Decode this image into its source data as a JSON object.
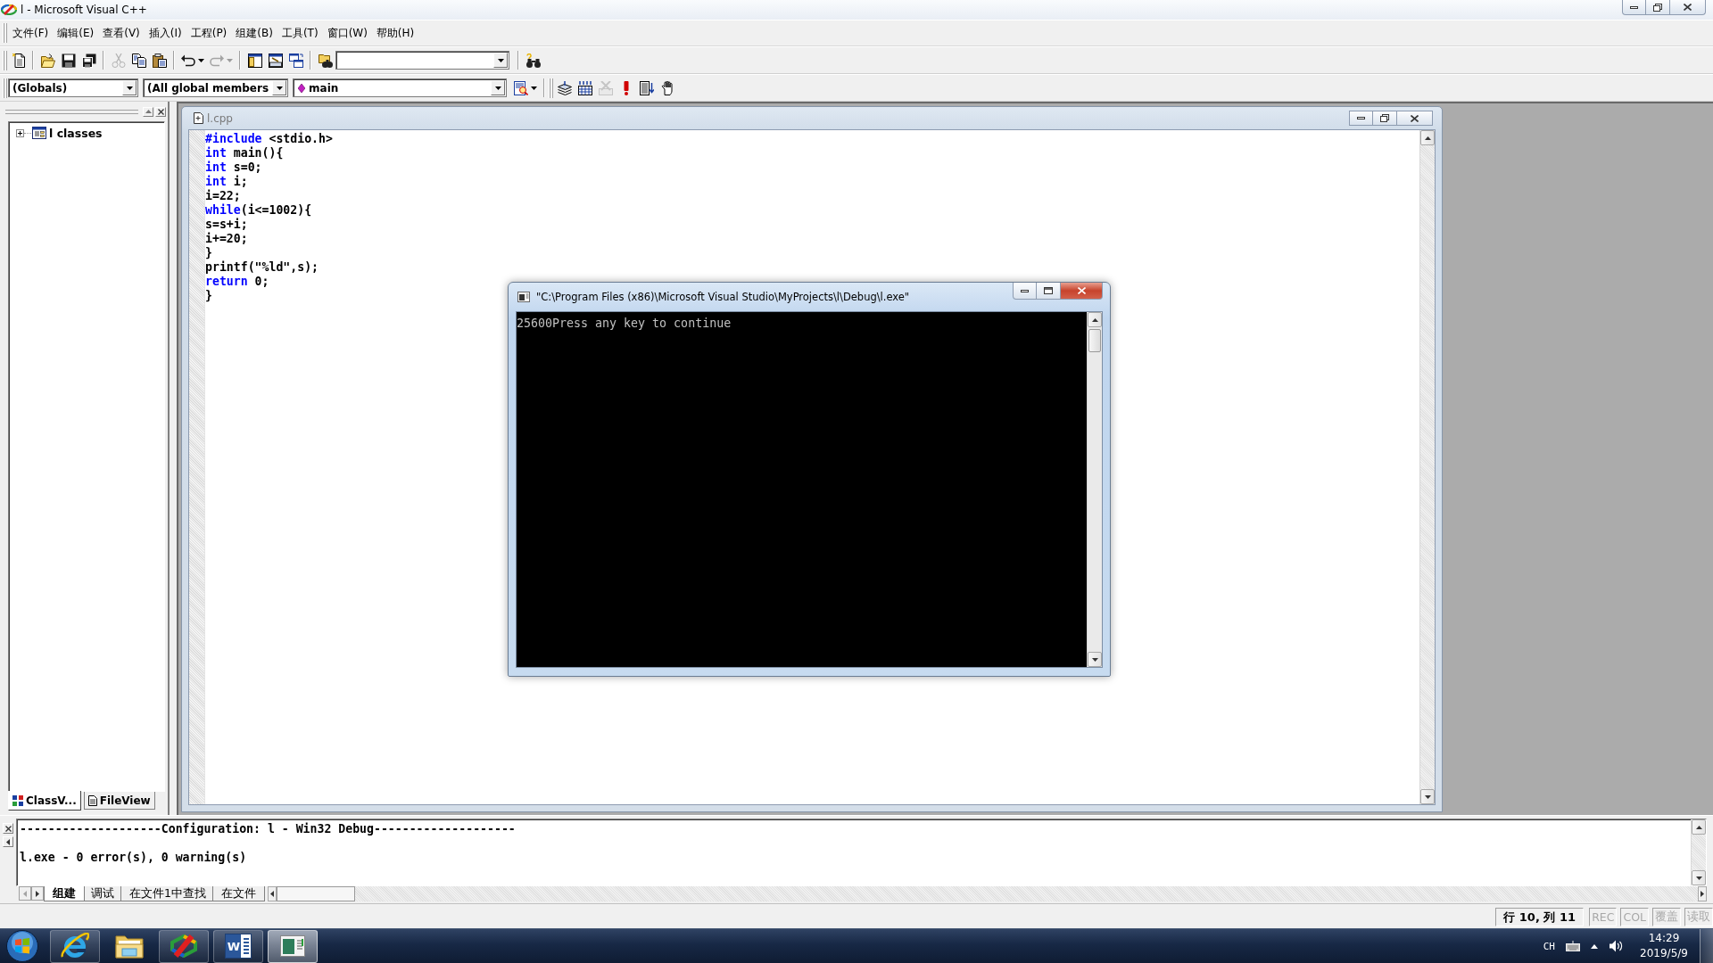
{
  "window": {
    "title": "l - Microsoft Visual C++"
  },
  "menu": [
    "文件(F)",
    "编辑(E)",
    "查看(V)",
    "插入(I)",
    "工程(P)",
    "组建(B)",
    "工具(T)",
    "窗口(W)",
    "帮助(H)"
  ],
  "standard_toolbar": [
    [
      {
        "kind": "new",
        "disabled": false
      }
    ],
    [
      {
        "kind": "open",
        "disabled": false
      },
      {
        "kind": "save",
        "disabled": false
      },
      {
        "kind": "save_all",
        "disabled": false
      }
    ],
    [
      {
        "kind": "cut",
        "disabled": true
      },
      {
        "kind": "copy",
        "disabled": false
      },
      {
        "kind": "paste",
        "disabled": false
      }
    ],
    [
      {
        "kind": "undo",
        "disabled": false
      },
      {
        "kind": "redo",
        "disabled": true
      }
    ],
    [
      {
        "kind": "workspace",
        "disabled": false
      },
      {
        "kind": "output",
        "disabled": false
      },
      {
        "kind": "windows",
        "disabled": false
      }
    ],
    [
      {
        "kind": "find_in_files",
        "disabled": false
      },
      {
        "kind": "combo",
        "disabled": false
      }
    ],
    [
      {
        "kind": "find",
        "disabled": false
      }
    ]
  ],
  "wizard_bar": {
    "class": "(Globals)",
    "members": "(All global members",
    "function": "main",
    "actions": [
      {
        "kind": "wizard",
        "disabled": false
      }
    ]
  },
  "build_toolbar": [
    {
      "kind": "compile",
      "disabled": false
    },
    {
      "kind": "build",
      "disabled": false
    },
    {
      "kind": "stop",
      "disabled": true
    },
    {
      "kind": "execute",
      "disabled": false
    },
    {
      "kind": "go",
      "disabled": false
    },
    {
      "kind": "breakpoint",
      "disabled": false
    }
  ],
  "workspace": {
    "tree": [
      {
        "label": "l classes",
        "expanded": false
      }
    ],
    "tabs": [
      {
        "kind": "classes",
        "label": "ClassV...",
        "selected": true
      },
      {
        "kind": "files",
        "label": "FileView",
        "selected": false
      }
    ]
  },
  "editor": {
    "title": "l.cpp",
    "active": false,
    "lines": [
      [
        {
          "text": "#include",
          "keyword": true
        },
        {
          "text": " <stdio.h>",
          "keyword": false
        }
      ],
      [
        {
          "text": "int",
          "keyword": true
        },
        {
          "text": " main(){",
          "keyword": false
        }
      ],
      [
        {
          "text": "int",
          "keyword": true
        },
        {
          "text": " s=0;",
          "keyword": false
        }
      ],
      [
        {
          "text": "int",
          "keyword": true
        },
        {
          "text": " i;",
          "keyword": false
        }
      ],
      [
        {
          "text": "i=22;",
          "keyword": false
        }
      ],
      [
        {
          "text": "while",
          "keyword": true
        },
        {
          "text": "(i<=1002){",
          "keyword": false
        }
      ],
      [
        {
          "text": "s=s+i;",
          "keyword": false
        }
      ],
      [
        {
          "text": "i+=20;",
          "keyword": false
        }
      ],
      [
        {
          "text": "}",
          "keyword": false
        }
      ],
      [
        {
          "text": "printf(\"%ld\",s);",
          "keyword": false
        }
      ],
      [
        {
          "text": "return",
          "keyword": true
        },
        {
          "text": " 0;",
          "keyword": false
        }
      ],
      [
        {
          "text": "}",
          "keyword": false
        }
      ]
    ]
  },
  "console": {
    "title": "\"C:\\Program Files (x86)\\Microsoft Visual Studio\\MyProjects\\l\\Debug\\l.exe\"",
    "active": true,
    "output": "25600Press any key to continue"
  },
  "output": {
    "lines": [
      "--------------------Configuration: l - Win32 Debug--------------------",
      "l.exe - 0 error(s), 0 warning(s)"
    ],
    "tabs": [
      {
        "label": "组建",
        "selected": true
      },
      {
        "label": "调试",
        "selected": false
      },
      {
        "label": "在文件1中查找",
        "selected": false
      },
      {
        "label": "在文件",
        "selected": false
      }
    ]
  },
  "status_bar": {
    "position": "行 10, 列 11",
    "indicators": [
      {
        "label": "REC",
        "enabled": false
      },
      {
        "label": "COL",
        "enabled": false
      },
      {
        "label": "覆盖",
        "enabled": false
      },
      {
        "label": "读取",
        "enabled": false
      }
    ]
  },
  "taskbar": {
    "buttons": [
      {
        "kind": "browser",
        "running": true,
        "selected": false
      },
      {
        "kind": "folder",
        "running": false,
        "selected": false
      },
      {
        "kind": "ide",
        "running": true,
        "selected": false
      },
      {
        "kind": "word",
        "glyph": "W",
        "running": true,
        "selected": false
      },
      {
        "kind": "console",
        "running": true,
        "selected": true
      }
    ],
    "tray": {
      "language": "CH",
      "time": "14:29",
      "date": "2019/5/9"
    }
  }
}
